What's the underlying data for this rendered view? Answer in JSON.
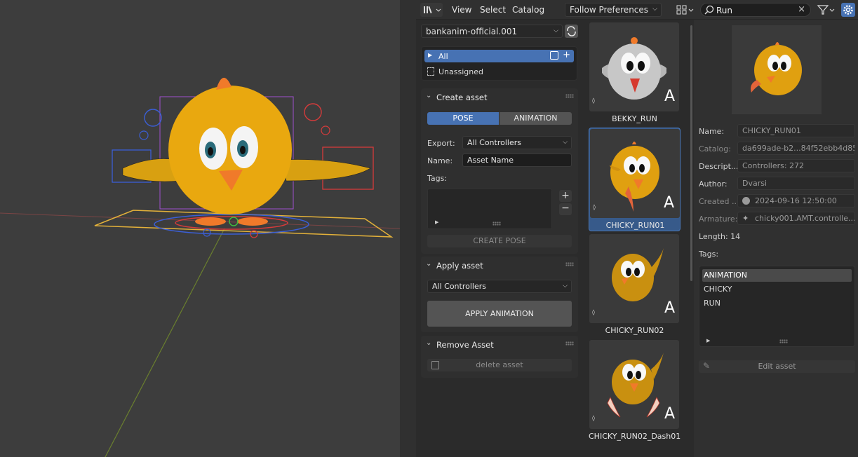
{
  "menubar": {
    "menus": [
      "View",
      "Select",
      "Catalog"
    ],
    "library_mode": "Follow Preferences",
    "search_value": "Run"
  },
  "library": {
    "name": "bankanim-official.001",
    "catalogs": [
      "All",
      "Unassigned"
    ]
  },
  "create_asset": {
    "title": "Create asset",
    "mode_tabs": [
      "POSE",
      "ANIMATION"
    ],
    "active_tab": "POSE",
    "export_label": "Export:",
    "export_value": "All Controllers",
    "name_label": "Name:",
    "name_value": "Asset Name",
    "tags_label": "Tags:",
    "create_button": "CREATE POSE"
  },
  "apply_asset": {
    "title": "Apply asset",
    "controllers_value": "All Controllers",
    "apply_button": "APPLY ANIMATION"
  },
  "remove_asset": {
    "title": "Remove Asset",
    "delete_button": "delete asset"
  },
  "assets": [
    {
      "name": "BEKKY_RUN",
      "badge": "A",
      "selected": false
    },
    {
      "name": "CHICKY_RUN01",
      "badge": "A",
      "selected": true
    },
    {
      "name": "CHICKY_RUN02",
      "badge": "A",
      "selected": false
    },
    {
      "name": "CHICKY_RUN02_Dash01",
      "badge": "A",
      "selected": false
    }
  ],
  "details": {
    "name_label": "Name:",
    "name_value": "CHICKY_RUN01",
    "catalog_label": "Catalog:",
    "catalog_value": "da699ade-b2...84f52ebb4d85",
    "description_label": "Descript...",
    "description_value": "Controllers: 272",
    "author_label": "Author:",
    "author_value": "Dvarsi",
    "created_label": "Created ...",
    "created_value": "2024-09-16 12:50:00",
    "armature_label": "Armature:",
    "armature_value": "chicky001.AMT.controlle...",
    "length_text": "Length: 14",
    "tags_label": "Tags:",
    "tags": [
      "ANIMATION",
      "CHICKY",
      "RUN"
    ],
    "edit_button": "Edit asset"
  },
  "colors": {
    "accent": "#4772b3",
    "panel": "#2f2f2f",
    "background": "#2b2b2b"
  }
}
